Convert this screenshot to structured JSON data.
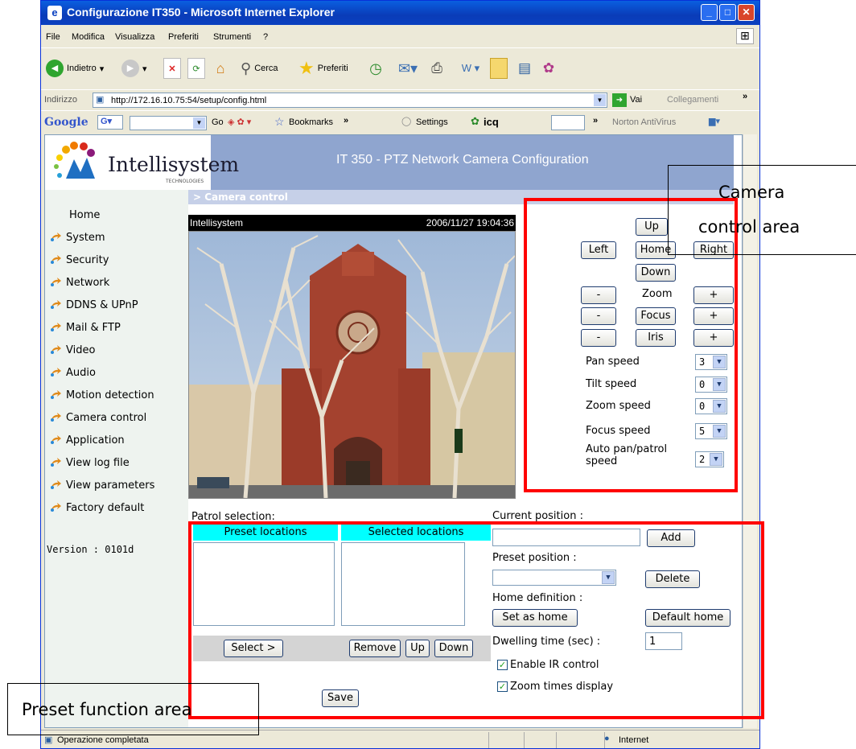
{
  "window": {
    "title": "Configurazione IT350 - Microsoft Internet Explorer"
  },
  "menu": [
    "File",
    "Modifica",
    "Visualizza",
    "Preferiti",
    "Strumenti",
    "?"
  ],
  "toolbar": {
    "back": "Indietro",
    "search": "Cerca",
    "favorites": "Preferiti"
  },
  "address": {
    "label": "Indirizzo",
    "url": "http://172.16.10.75:54/setup/config.html",
    "go": "Vai",
    "links": "Collegamenti"
  },
  "google": {
    "logo": "Google",
    "go": "Go",
    "bookmarks": "Bookmarks",
    "settings": "Settings",
    "icq": "icq",
    "norton": "Norton AntiVirus"
  },
  "header": {
    "logo_text": "Intellisystem",
    "logo_sub": "TECHNOLOGIES",
    "title": "IT 350 - PTZ Network Camera Configuration"
  },
  "breadcrumb": "> Camera control",
  "nav": {
    "home": "Home",
    "items": [
      "System",
      "Security",
      "Network",
      "DDNS & UPnP",
      "Mail & FTP",
      "Video",
      "Audio",
      "Motion detection",
      "Camera control",
      "Application",
      "View log file",
      "View parameters",
      "Factory default"
    ],
    "version": "Version : 0101d"
  },
  "camera": {
    "name": "Intellisystem",
    "timestamp": "2006/11/27 19:04:36"
  },
  "controls": {
    "up": "Up",
    "left": "Left",
    "home": "Home",
    "right": "Right",
    "down": "Down",
    "minus": "-",
    "plus": "+",
    "zoom": "Zoom",
    "focus": "Focus",
    "iris": "Iris",
    "pan_speed": {
      "label": "Pan speed",
      "value": "3"
    },
    "tilt_speed": {
      "label": "Tilt speed",
      "value": "0"
    },
    "zoom_speed": {
      "label": "Zoom speed",
      "value": "0"
    },
    "focus_speed": {
      "label": "Focus speed",
      "value": "5"
    },
    "auto_pan": {
      "label": "Auto pan/patrol speed",
      "value": "2"
    }
  },
  "patrol": {
    "label": "Patrol selection:",
    "preset_header": "Preset locations",
    "selected_header": "Selected locations",
    "select_btn": "Select >",
    "remove_btn": "Remove",
    "up_btn": "Up",
    "down_btn": "Down",
    "save_btn": "Save"
  },
  "preset": {
    "current_label": "Current position :",
    "current_value": "",
    "add_btn": "Add",
    "preset_label": "Preset position :",
    "preset_value": "",
    "delete_btn": "Delete",
    "home_label": "Home definition :",
    "set_home_btn": "Set as home",
    "default_home_btn": "Default home",
    "dwell_label": "Dwelling time (sec) :",
    "dwell_value": "1",
    "ir_label": "Enable IR control",
    "ir_checked": true,
    "zoom_display_label": "Zoom times display",
    "zoom_display_checked": true
  },
  "status": {
    "left": "Operazione completata",
    "zone": "Internet"
  },
  "annotations": {
    "camera_area_line1": "Camera",
    "camera_area_line2": "control area",
    "preset_area": "Preset function area",
    "highlight_color": "#ff0000"
  }
}
